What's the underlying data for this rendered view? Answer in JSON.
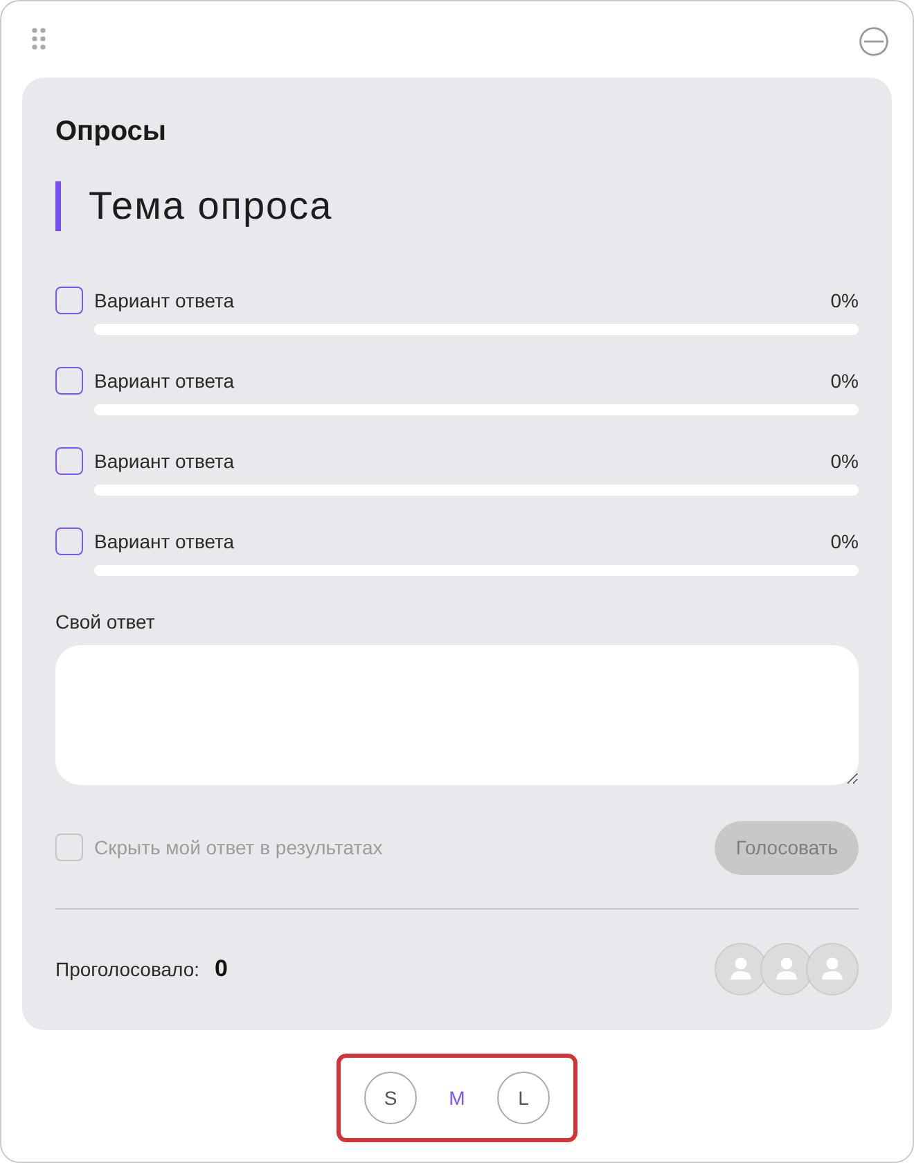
{
  "card": {
    "title": "Опросы",
    "topic": "Тема опроса"
  },
  "options": [
    {
      "label": "Вариант ответа",
      "checked": false,
      "level": 0,
      "percent": "0%"
    },
    {
      "label": "Вариант ответа",
      "checked": false,
      "level": 0,
      "percent": "0%"
    },
    {
      "label": "Вариант ответа",
      "checked": false,
      "level": 0,
      "percent": "0%"
    },
    {
      "label": "Вариант ответа",
      "checked": false,
      "level": 0,
      "percent": "0%"
    }
  ],
  "own_answer": {
    "label": "Свой ответ"
  },
  "hide_answer": {
    "label": "Скрыть мой ответ в результатах",
    "checked": false,
    "disabled": true
  },
  "vote_button": {
    "label": "Голосовать",
    "disabled": true
  },
  "voters": {
    "label": "Проголосовало:",
    "count": "0"
  },
  "sizes": [
    {
      "label": "S",
      "selected": false
    },
    {
      "label": "M",
      "selected": true
    },
    {
      "label": "L",
      "selected": false
    }
  ]
}
